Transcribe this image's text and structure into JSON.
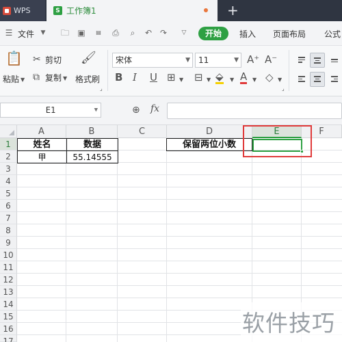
{
  "tabs": {
    "app": "WPS",
    "document": "工作簿1"
  },
  "menubar": {
    "file": "文件",
    "start": "开始",
    "insert": "插入",
    "page_layout": "页面布局",
    "formula": "公式"
  },
  "ribbon": {
    "paste": "粘贴",
    "cut": "剪切",
    "copy": "复制",
    "format_painter": "格式刷",
    "font_name": "宋体",
    "font_size": "11"
  },
  "formula_bar": {
    "name_box": "E1",
    "fx": "fx",
    "formula": ""
  },
  "grid": {
    "columns": [
      "A",
      "B",
      "C",
      "D",
      "E",
      "F"
    ],
    "rows": [
      "1",
      "2",
      "3",
      "4",
      "5",
      "6",
      "7",
      "8",
      "9",
      "10",
      "11",
      "12",
      "13",
      "14",
      "15",
      "16",
      "17"
    ],
    "cells": {
      "A1": "姓名",
      "B1": "数据",
      "A2": "甲",
      "B2": "55.14555",
      "D1": "保留两位小数"
    },
    "selected_cell": "E1"
  },
  "watermark": "软件技巧",
  "colors": {
    "accent": "#2ea043",
    "highlight": "#e03a3a",
    "titlebar": "#2f3541"
  }
}
